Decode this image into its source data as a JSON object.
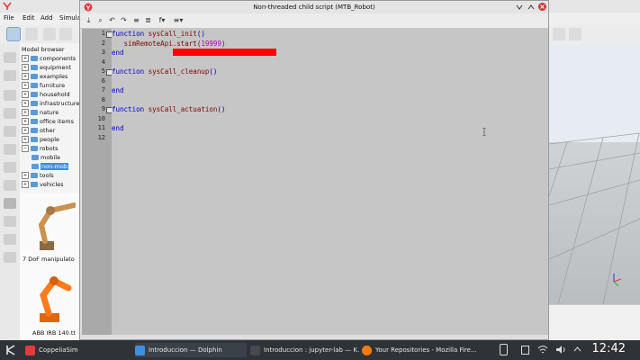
{
  "app": {
    "menu": [
      "File",
      "Edit",
      "Add",
      "Simula"
    ],
    "model_browser_title": "Model browser",
    "tree": [
      {
        "label": "components",
        "expanded": false
      },
      {
        "label": "equipment",
        "expanded": false
      },
      {
        "label": "examples",
        "expanded": false
      },
      {
        "label": "furniture",
        "expanded": false
      },
      {
        "label": "household",
        "expanded": false
      },
      {
        "label": "infrastructure",
        "expanded": false
      },
      {
        "label": "nature",
        "expanded": false
      },
      {
        "label": "office items",
        "expanded": false
      },
      {
        "label": "other",
        "expanded": false
      },
      {
        "label": "people",
        "expanded": false
      },
      {
        "label": "robots",
        "expanded": true
      },
      {
        "label": "mobile",
        "child": true
      },
      {
        "label": "non-mob",
        "child": true,
        "selected": true
      },
      {
        "label": "tools",
        "expanded": false
      },
      {
        "label": "vehicles",
        "expanded": false
      }
    ],
    "thumbnails": [
      {
        "label": "7 DoF manipulato",
        "color": "#c9924f"
      },
      {
        "label": "ABB IRB 140.tt",
        "color": "#ff7a1a"
      }
    ]
  },
  "editor": {
    "title": "Non-threaded child script (MTB_Robot)",
    "lines": [
      {
        "n": "1",
        "parts": [
          [
            "kw",
            "function "
          ],
          [
            "fn",
            "sysCall_init"
          ],
          [
            "kw",
            "()"
          ]
        ]
      },
      {
        "n": "2",
        "parts": [
          [
            "fn",
            "   simRemoteApi.start("
          ],
          [
            "num",
            "19999"
          ],
          [
            "fn",
            ")"
          ]
        ]
      },
      {
        "n": "3",
        "parts": [
          [
            "kw",
            "end"
          ]
        ]
      },
      {
        "n": "4",
        "parts": []
      },
      {
        "n": "5",
        "parts": [
          [
            "kw",
            "function "
          ],
          [
            "fn",
            "sysCall_cleanup"
          ],
          [
            "kw",
            "()"
          ]
        ]
      },
      {
        "n": "6",
        "parts": []
      },
      {
        "n": "7",
        "parts": [
          [
            "kw",
            "end"
          ]
        ]
      },
      {
        "n": "8",
        "parts": []
      },
      {
        "n": "9",
        "parts": [
          [
            "kw",
            "function "
          ],
          [
            "fn",
            "sysCall_actuation"
          ],
          [
            "kw",
            "()"
          ]
        ]
      },
      {
        "n": "10",
        "parts": []
      },
      {
        "n": "11",
        "parts": [
          [
            "kw",
            "end"
          ]
        ]
      },
      {
        "n": "12",
        "parts": []
      }
    ]
  },
  "taskbar": {
    "items": [
      {
        "label": "CoppeliaSim",
        "color": "#e23b3b"
      },
      {
        "label": "Introduccion — Dolphin",
        "color": "#3d8fe0"
      },
      {
        "label": "Introduccion : jupyter-lab — K...",
        "color": "#444a52"
      },
      {
        "label": "Your Repositories - Mozilla Fire...",
        "color": "#ff7b00"
      }
    ],
    "clock": "12:42"
  }
}
